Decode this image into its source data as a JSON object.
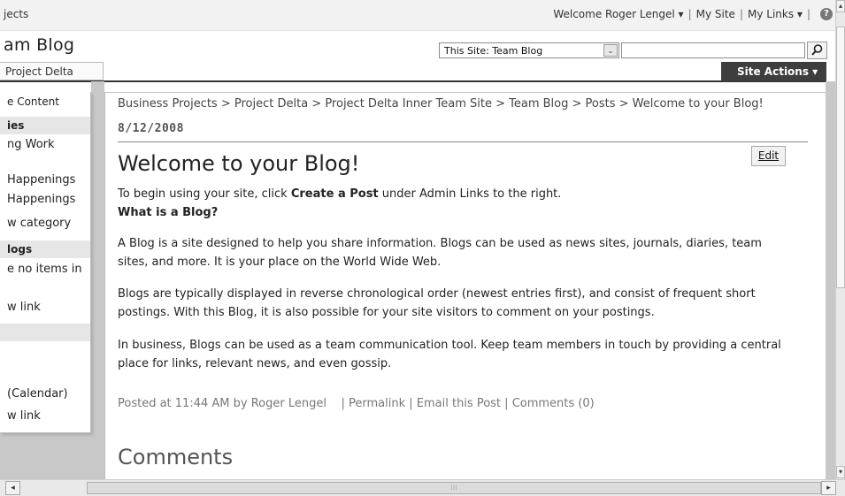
{
  "topbar": {
    "crumb": "jects",
    "welcome": "Welcome Roger Lengel",
    "my_site": "My Site",
    "my_links": "My Links",
    "dropdown_glyph": "▾",
    "separator": "|",
    "help_glyph": "?"
  },
  "header": {
    "site_title": "am Blog",
    "search_scope": "This Site: Team Blog",
    "search_value": "",
    "select_glyph": "⌄"
  },
  "tabs": {
    "current": "Project Delta",
    "site_actions": "Site Actions ▾"
  },
  "leftnav": {
    "items": [
      {
        "label": "e Content",
        "type": "item"
      },
      {
        "label": "ies",
        "type": "head"
      },
      {
        "label": "ng Work",
        "type": "item"
      },
      {
        "label": "Happenings",
        "type": "item"
      },
      {
        "label": "Happenings",
        "type": "item"
      },
      {
        "label": "w category",
        "type": "item"
      },
      {
        "label": "logs",
        "type": "head"
      },
      {
        "label": "e no items in",
        "type": "item"
      },
      {
        "label": "w link",
        "type": "item"
      },
      {
        "label": "",
        "type": "head"
      },
      {
        "label": "",
        "type": "item"
      },
      {
        "label": "(Calendar)",
        "type": "item"
      },
      {
        "label": "w link",
        "type": "item"
      }
    ]
  },
  "main": {
    "breadcrumb": "Business Projects > Project Delta > Project Delta Inner Team Site > Team Blog > Posts > Welcome to your Blog!",
    "date": "8/12/2008",
    "title": "Welcome to your Blog!",
    "edit_label": "Edit",
    "intro_pre": "To begin using your site, click ",
    "intro_bold": "Create a Post",
    "intro_post": " under Admin Links to the right.",
    "what_is": "What is a Blog?",
    "para1": "A Blog is a site designed to help you share information. Blogs can be used as news sites, journals, diaries, team sites, and more. It is your place on the World Wide Web.",
    "para2": "Blogs are typically displayed in reverse chronological order (newest entries first), and consist of frequent short postings. With this Blog, it is also possible for your site visitors to comment on your postings.",
    "para3": "In business, Blogs can be used as a team communication tool. Keep team members in touch by providing a central place for links, relevant news, and even gossip.",
    "posted": "Posted at 11:44 AM by Roger Lengel",
    "permalink": "Permalink",
    "email_post": "Email this Post",
    "comments_link": "Comments (0)",
    "comments_title": "Comments"
  },
  "scrollbars": {
    "up": "▴",
    "down": "▾",
    "left": "◂",
    "right": "▸",
    "grip": "⁞⁞⁞"
  }
}
